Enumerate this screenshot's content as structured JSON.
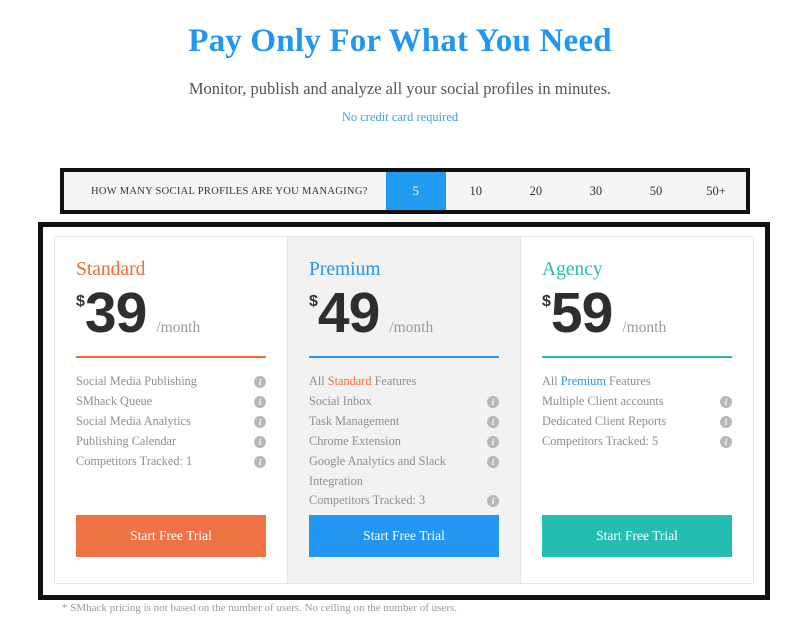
{
  "header": {
    "title": "Pay Only For What You Need",
    "subtitle": "Monitor, publish and analyze all your social profiles in minutes.",
    "note": "No credit card required",
    "title_color": "#2196f3"
  },
  "selector": {
    "question": "HOW MANY SOCIAL PROFILES ARE YOU MANAGING?",
    "selected": "5",
    "selected_color": "#1f9bef",
    "options": [
      {
        "label": "5",
        "selected": true
      },
      {
        "label": "10",
        "selected": false
      },
      {
        "label": "20",
        "selected": false
      },
      {
        "label": "30",
        "selected": false
      },
      {
        "label": "50",
        "selected": false
      },
      {
        "label": "50+",
        "selected": false
      }
    ]
  },
  "plans": [
    {
      "name": "Standard",
      "color": "#ef6c35",
      "currency": "$",
      "amount": "39",
      "period": "/month",
      "highlight": false,
      "features": [
        {
          "text": "Social Media Publishing",
          "info": true
        },
        {
          "text": "SMhack Queue",
          "info": true
        },
        {
          "text": "Social Media Analytics",
          "info": true
        },
        {
          "text": "Publishing Calendar",
          "info": true
        },
        {
          "text": "Competitors Tracked: 1",
          "info": true
        }
      ],
      "cta": "Start Free Trial",
      "cta_color": "#ef7245"
    },
    {
      "name": "Premium",
      "color": "#2196f3",
      "currency": "$",
      "amount": "49",
      "period": "/month",
      "highlight": true,
      "features": [
        {
          "prefix": "All ",
          "accent": "Standard",
          "accent_color": "orange",
          "suffix": " Features",
          "info": false
        },
        {
          "text": "Social Inbox",
          "info": true
        },
        {
          "text": "Task Management",
          "info": true
        },
        {
          "text": "Chrome Extension",
          "info": true
        },
        {
          "text": "Google Analytics and Slack Integration",
          "info": true
        },
        {
          "text": "Competitors Tracked: 3",
          "info": true
        }
      ],
      "cta": "Start Free Trial",
      "cta_color": "#2196f3"
    },
    {
      "name": "Agency",
      "color": "#25bdb2",
      "currency": "$",
      "amount": "59",
      "period": "/month",
      "highlight": false,
      "features": [
        {
          "prefix": "All ",
          "accent": "Premium",
          "accent_color": "blue",
          "suffix": " Features",
          "info": false
        },
        {
          "text": "Multiple Client accounts",
          "info": true
        },
        {
          "text": "Dedicated Client Reports",
          "info": true
        },
        {
          "text": "Competitors Tracked: 5",
          "info": true
        }
      ],
      "cta": "Start Free Trial",
      "cta_color": "#25bdb2"
    }
  ],
  "footnote": "* SMhack pricing is not based on the number of users. No ceiling on the number of users.",
  "info_icon_glyph": "i"
}
